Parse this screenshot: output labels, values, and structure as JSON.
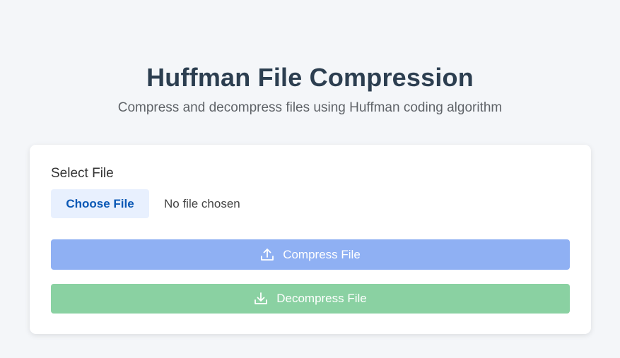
{
  "header": {
    "title": "Huffman File Compression",
    "subtitle": "Compress and decompress files using Huffman coding algorithm"
  },
  "form": {
    "label": "Select File",
    "choose_button": "Choose File",
    "file_status": "No file chosen"
  },
  "actions": {
    "compress": {
      "label": "Compress File",
      "icon": "upload-icon",
      "color": "#8fb0f3"
    },
    "decompress": {
      "label": "Decompress File",
      "icon": "download-icon",
      "color": "#8ad1a2"
    }
  },
  "colors": {
    "background": "#f4f6f9",
    "title": "#2c3e50",
    "choose_bg": "#e8f0fe",
    "choose_text": "#0a58b5"
  }
}
